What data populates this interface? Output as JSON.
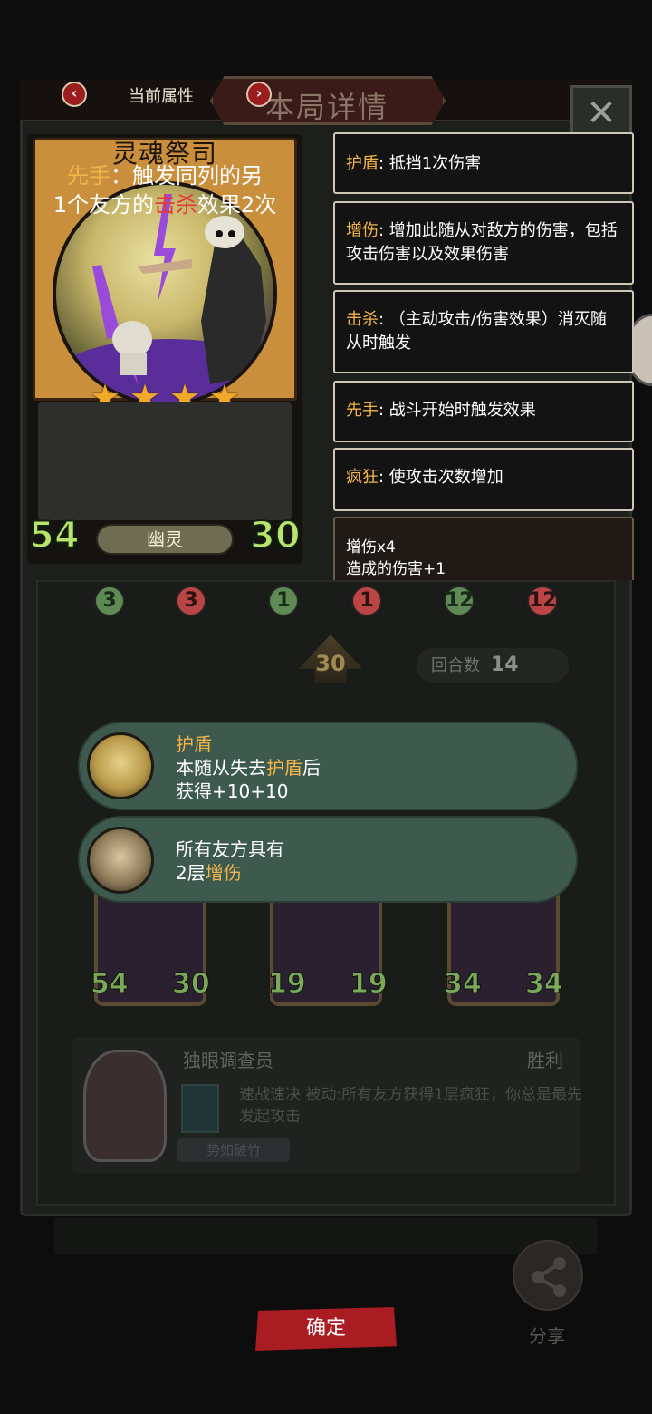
{
  "header": {
    "current_tab": "当前属性",
    "detail_tab": "本局详情",
    "prev_symbol": "‹",
    "next_symbol": "›",
    "close_symbol": "✕"
  },
  "card": {
    "name": "灵魂祭司",
    "stars": 4,
    "star_glyph": "★",
    "desc_line1_kw": "先手",
    "desc_line1_rest": "：触发同列的另",
    "desc_line2_pre": "1个友方的",
    "desc_line2_kw": "击杀",
    "desc_line2_post": "效果2次",
    "attack": "54",
    "health": "30",
    "tribe": "幽灵"
  },
  "keywords": [
    {
      "kw": "护盾",
      "text": ": 抵挡1次伤害"
    },
    {
      "kw": "增伤",
      "text": ": 增加此随从对敌方的伤害，包括攻击伤害以及效果伤害"
    },
    {
      "kw": "击杀",
      "text": ": （主动攻击/伤害效果）消灭随从时触发"
    },
    {
      "kw": "先手",
      "text": ": 战斗开始时触发效果"
    },
    {
      "kw": "疯狂",
      "text": ": 使攻击次数增加"
    }
  ],
  "buff": {
    "line1": "增伤x4",
    "line2": "造成的伤害+1"
  },
  "row1": [
    {
      "a": "3",
      "h": "3"
    },
    {
      "a": "1",
      "h": "1"
    },
    {
      "a": "12",
      "h": "12"
    }
  ],
  "upgrade": "30",
  "round": {
    "label": "回合数",
    "value": "14"
  },
  "popups": [
    {
      "title": "护盾",
      "line2_pre": "本随从失去",
      "line2_kw": "护盾",
      "line2_post": "后",
      "line3": "获得+10+10"
    },
    {
      "line1": "所有友方具有",
      "line2_pre": "2层",
      "line2_kw": "增伤"
    }
  ],
  "bigcards": [
    {
      "a": "54",
      "h": "30"
    },
    {
      "a": "19",
      "h": "19"
    },
    {
      "a": "34",
      "h": "34"
    }
  ],
  "enemy": {
    "name": "独眼调查员",
    "result": "胜利",
    "skill": "速战速决 被动:所有友方获得1层疯狂，你总是最先发起攻击",
    "tag": "势如破竹"
  },
  "confirm": "确定",
  "share": "分享",
  "colors": {
    "keyword": "#f2b44a",
    "keyword_red": "#e23b3b",
    "stat": "#b9e36a",
    "confirm": "#a81c22",
    "popup": "#3e5a4e"
  }
}
